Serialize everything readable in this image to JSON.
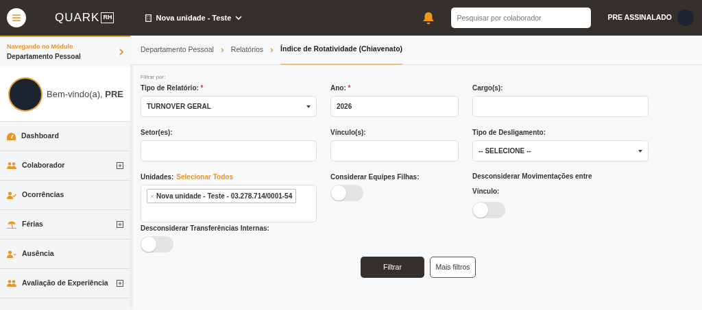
{
  "header": {
    "logo_text": "QUARK",
    "logo_badge": "RH",
    "unit": "Nova unidade - Teste",
    "search": {
      "placeholder": "Pesquisar por colaborador"
    },
    "user": "PRE ASSINALADO"
  },
  "sidebar": {
    "module_caption": "Navegando no Módulo",
    "module": "Departamento Pessoal",
    "welcome": "Bem-vindo(a), **PRE**",
    "items": [
      {
        "label": "Dashboard",
        "expandable": false
      },
      {
        "label": "Colaborador",
        "expandable": true
      },
      {
        "label": "Ocorrências",
        "expandable": false
      },
      {
        "label": "Férias",
        "expandable": true
      },
      {
        "label": "Ausência",
        "expandable": false
      },
      {
        "label": "Avaliação de Experiência",
        "expandable": true
      }
    ]
  },
  "breadcrumb": [
    {
      "label": "Departamento Pessoal",
      "selected": false
    },
    {
      "label": "Relatórios",
      "selected": false
    },
    {
      "label": "Índice de Rotatividade (Chiavenato)",
      "selected": true
    }
  ],
  "filter_caption": "Filtrar por:",
  "fields": [
    {
      "kind": "select",
      "label": "Tipo de Relatório:",
      "required_mark": "*",
      "value": "TURNOVER GERAL"
    },
    {
      "kind": "input",
      "label": "Ano:",
      "required_mark": "*",
      "value": "2026"
    },
    {
      "kind": "input",
      "label": "Cargo(s):"
    },
    {
      "kind": "input",
      "label": "Setor(es):"
    },
    {
      "kind": "input",
      "label": "Vínculo(s):"
    },
    {
      "kind": "select",
      "label": "Tipo de Desligamento:",
      "value": "-- SELECIONE --"
    },
    {
      "kind": "multi",
      "label": "Unidades:",
      "link": "Selecionar Todos",
      "tags": [
        "Nova unidade - Teste - 03.278.714/0001-54"
      ]
    },
    {
      "kind": "switch",
      "label": "Considerar Equipes Filhas:",
      "on": false
    },
    {
      "kind": "switch",
      "label": "Desconsiderar Movimentações entre Vínculo:",
      "on": false
    },
    {
      "kind": "switch",
      "label": "Desconsiderar Transferências Internas:",
      "on": false
    }
  ],
  "buttons": [
    {
      "label": "Filtrar",
      "kind": "primary"
    },
    {
      "label": "Mais filtros",
      "kind": "outline"
    }
  ]
}
